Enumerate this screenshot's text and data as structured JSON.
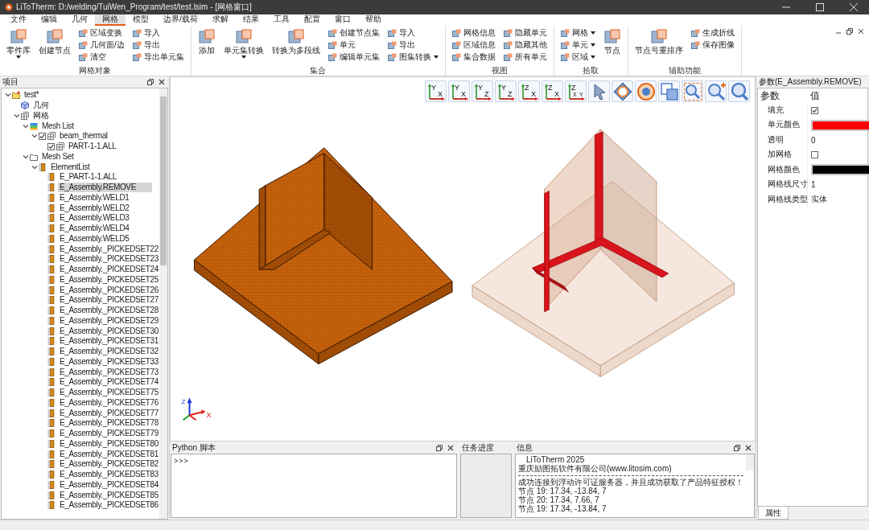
{
  "window": {
    "title": "LiToTherm: D:/welding/TuiWen_Program/test/test.lsim - [网格窗口]"
  },
  "menu": [
    {
      "label": "文件",
      "selected": false
    },
    {
      "label": "编辑",
      "selected": false
    },
    {
      "label": "几何",
      "selected": false
    },
    {
      "label": "网格",
      "selected": true
    },
    {
      "label": "模型",
      "selected": false
    },
    {
      "label": "边界/载荷",
      "selected": false
    },
    {
      "label": "求解",
      "selected": false
    },
    {
      "label": "结果",
      "selected": false
    },
    {
      "label": "工具",
      "selected": false
    },
    {
      "label": "配置",
      "selected": false
    },
    {
      "label": "窗口",
      "selected": false
    },
    {
      "label": "帮助",
      "selected": false
    }
  ],
  "ribbon": {
    "groups": [
      {
        "label": "网格对象",
        "items": [
          {
            "kind": "large",
            "label": "零件库",
            "dropdown": true
          },
          {
            "kind": "large",
            "label": "创建节点",
            "dropdown": false
          },
          {
            "kind": "column",
            "buttons": [
              {
                "label": "区域变换",
                "dropdown": false
              },
              {
                "label": "几何面/边",
                "dropdown": false
              },
              {
                "label": "清空",
                "dropdown": false
              }
            ]
          },
          {
            "kind": "column",
            "buttons": [
              {
                "label": "导入",
                "dropdown": false
              },
              {
                "label": "导出",
                "dropdown": false
              },
              {
                "label": "导出单元集",
                "dropdown": false
              }
            ]
          }
        ]
      },
      {
        "label": "集合",
        "items": [
          {
            "kind": "large",
            "label": "添加",
            "dropdown": false
          },
          {
            "kind": "large",
            "label": "单元集转换",
            "dropdown": true
          },
          {
            "kind": "large",
            "label": "转换为多段线",
            "dropdown": false
          },
          {
            "kind": "column",
            "buttons": [
              {
                "label": "创建节点集",
                "dropdown": false
              },
              {
                "label": "单元",
                "dropdown": false
              },
              {
                "label": "编辑单元集",
                "dropdown": false
              }
            ]
          },
          {
            "kind": "column",
            "buttons": [
              {
                "label": "导入",
                "dropdown": false
              },
              {
                "label": "导出",
                "dropdown": false
              },
              {
                "label": "图集转换",
                "dropdown": true
              }
            ]
          }
        ]
      },
      {
        "label": "视图",
        "items": [
          {
            "kind": "column",
            "buttons": [
              {
                "label": "网格信息",
                "dropdown": false
              },
              {
                "label": "区域信息",
                "dropdown": false
              },
              {
                "label": "集合数据",
                "dropdown": false
              }
            ]
          },
          {
            "kind": "column",
            "buttons": [
              {
                "label": "隐藏单元",
                "dropdown": false
              },
              {
                "label": "隐藏其他",
                "dropdown": false
              },
              {
                "label": "所有单元",
                "dropdown": false
              }
            ]
          }
        ]
      },
      {
        "label": "拾取",
        "items": [
          {
            "kind": "column",
            "buttons": [
              {
                "label": "网格",
                "dropdown": true
              },
              {
                "label": "单元",
                "dropdown": true
              },
              {
                "label": "区域",
                "dropdown": true
              }
            ]
          },
          {
            "kind": "large",
            "label": "节点",
            "dropdown": false
          }
        ]
      },
      {
        "label": "辅助功能",
        "items": [
          {
            "kind": "large",
            "label": "节点号重排序",
            "dropdown": false
          },
          {
            "kind": "column",
            "buttons": [
              {
                "label": "生成折线",
                "dropdown": false
              },
              {
                "label": "保存图像",
                "dropdown": false
              }
            ]
          }
        ]
      }
    ]
  },
  "tree": {
    "title": "项目",
    "items": [
      {
        "label": "test*",
        "kind": "project",
        "expanded": true,
        "selected": false,
        "children": [
          {
            "label": "几何",
            "kind": "geometry",
            "selected": false
          },
          {
            "label": "网格",
            "kind": "mesh",
            "expanded": true,
            "selected": false,
            "children": [
              {
                "label": "Mesh List",
                "kind": "meshlist",
                "expanded": true,
                "selected": false,
                "children": [
                  {
                    "label": "beam_thermal",
                    "kind": "mesh",
                    "checked": true,
                    "expanded": true,
                    "selected": false,
                    "children": [
                      {
                        "label": "PART-1-1.ALL",
                        "kind": "mesh",
                        "checked": true,
                        "selected": false
                      }
                    ]
                  }
                ]
              },
              {
                "label": "Mesh Set",
                "kind": "folder",
                "expanded": true,
                "selected": false,
                "children": [
                  {
                    "label": "ElementList",
                    "kind": "element",
                    "expanded": true,
                    "selected": false,
                    "children": [
                      {
                        "label": "E_PART-1-1.ALL",
                        "kind": "element",
                        "selected": false
                      },
                      {
                        "label": "E_Assembly.REMOVE",
                        "kind": "element",
                        "selected": true
                      },
                      {
                        "label": "E_Assembly.WELD1",
                        "kind": "element",
                        "selected": false
                      },
                      {
                        "label": "E_Assembly.WELD2",
                        "kind": "element",
                        "selected": false
                      },
                      {
                        "label": "E_Assembly.WELD3",
                        "kind": "element",
                        "selected": false
                      },
                      {
                        "label": "E_Assembly.WELD4",
                        "kind": "element",
                        "selected": false
                      },
                      {
                        "label": "E_Assembly.WELD5",
                        "kind": "element",
                        "selected": false
                      },
                      {
                        "label": "E_Assembly._PICKEDSET22",
                        "kind": "element",
                        "selected": false
                      },
                      {
                        "label": "E_Assembly._PICKEDSET23",
                        "kind": "element",
                        "selected": false
                      },
                      {
                        "label": "E_Assembly._PICKEDSET24",
                        "kind": "element",
                        "selected": false
                      },
                      {
                        "label": "E_Assembly._PICKEDSET25",
                        "kind": "element",
                        "selected": false
                      },
                      {
                        "label": "E_Assembly._PICKEDSET26",
                        "kind": "element",
                        "selected": false
                      },
                      {
                        "label": "E_Assembly._PICKEDSET27",
                        "kind": "element",
                        "selected": false
                      },
                      {
                        "label": "E_Assembly._PICKEDSET28",
                        "kind": "element",
                        "selected": false
                      },
                      {
                        "label": "E_Assembly._PICKEDSET29",
                        "kind": "element",
                        "selected": false
                      },
                      {
                        "label": "E_Assembly._PICKEDSET30",
                        "kind": "element",
                        "selected": false
                      },
                      {
                        "label": "E_Assembly._PICKEDSET31",
                        "kind": "element",
                        "selected": false
                      },
                      {
                        "label": "E_Assembly._PICKEDSET32",
                        "kind": "element",
                        "selected": false
                      },
                      {
                        "label": "E_Assembly._PICKEDSET33",
                        "kind": "element",
                        "selected": false
                      },
                      {
                        "label": "E_Assembly._PICKEDSET73",
                        "kind": "element",
                        "selected": false
                      },
                      {
                        "label": "E_Assembly._PICKEDSET74",
                        "kind": "element",
                        "selected": false
                      },
                      {
                        "label": "E_Assembly._PICKEDSET75",
                        "kind": "element",
                        "selected": false
                      },
                      {
                        "label": "E_Assembly._PICKEDSET76",
                        "kind": "element",
                        "selected": false
                      },
                      {
                        "label": "E_Assembly._PICKEDSET77",
                        "kind": "element",
                        "selected": false
                      },
                      {
                        "label": "E_Assembly._PICKEDSET78",
                        "kind": "element",
                        "selected": false
                      },
                      {
                        "label": "E_Assembly._PICKEDSET79",
                        "kind": "element",
                        "selected": false
                      },
                      {
                        "label": "E_Assembly._PICKEDSET80",
                        "kind": "element",
                        "selected": false
                      },
                      {
                        "label": "E_Assembly._PICKEDSET81",
                        "kind": "element",
                        "selected": false
                      },
                      {
                        "label": "E_Assembly._PICKEDSET82",
                        "kind": "element",
                        "selected": false
                      },
                      {
                        "label": "E_Assembly._PICKEDSET83",
                        "kind": "element",
                        "selected": false
                      },
                      {
                        "label": "E_Assembly._PICKEDSET84",
                        "kind": "element",
                        "selected": false
                      },
                      {
                        "label": "E_Assembly._PICKEDSET85",
                        "kind": "element",
                        "selected": false
                      },
                      {
                        "label": "E_Assembly._PICKEDSET86",
                        "kind": "element",
                        "selected": false
                      }
                    ]
                  }
                ]
              }
            ]
          }
        ]
      }
    ]
  },
  "view_toolbar": [
    {
      "kind": "axes",
      "labels": [
        "Y",
        "X"
      ]
    },
    {
      "kind": "axes",
      "labels": [
        "Y",
        "X"
      ]
    },
    {
      "kind": "axes",
      "labels": [
        "Y",
        "Z"
      ]
    },
    {
      "kind": "axes",
      "labels": [
        "Y",
        "Z"
      ]
    },
    {
      "kind": "axes",
      "labels": [
        "Z",
        "X"
      ]
    },
    {
      "kind": "axes",
      "labels": [
        "Z",
        "X"
      ]
    },
    {
      "kind": "axes",
      "labels": [
        "Z",
        "X",
        "Y"
      ]
    },
    {
      "kind": "pointer"
    },
    {
      "kind": "rotate"
    },
    {
      "kind": "circle"
    },
    {
      "kind": "box"
    },
    {
      "kind": "zoom-window"
    },
    {
      "kind": "zoom-in"
    },
    {
      "kind": "zoom-fit"
    }
  ],
  "triad": {
    "labels": [
      "Z",
      "X"
    ]
  },
  "properties": {
    "title": "参数(E_Assembly.REMOVE)",
    "columns": [
      "参数",
      "值"
    ],
    "rows": [
      {
        "name": "填充",
        "kind": "checkbox",
        "checked": true
      },
      {
        "name": "单元颜色",
        "kind": "color",
        "color": "#ff0000"
      },
      {
        "name": "透明",
        "kind": "text",
        "value": "0"
      },
      {
        "name": "加网格",
        "kind": "checkbox",
        "checked": false
      },
      {
        "name": "网格颜色",
        "kind": "color",
        "color": "#000000"
      },
      {
        "name": "网格线尺寸",
        "kind": "text",
        "value": "1"
      },
      {
        "name": "网格线类型",
        "kind": "text",
        "value": "实体"
      }
    ],
    "tab": "属性"
  },
  "python": {
    "title": "Python 脚本",
    "prompt": ">>>"
  },
  "tasks": {
    "title": "任务进度"
  },
  "info": {
    "title": "信息",
    "lines": [
      {
        "kind": "title",
        "text": "LiToTherm 2025"
      },
      {
        "kind": "text",
        "text": "重庆励图拓软件有限公司(www.litosim.com)"
      },
      {
        "kind": "rule"
      },
      {
        "kind": "text",
        "text": "成功连接到浮动许可证服务器，并且成功获取了产品特征授权！"
      },
      {
        "kind": "text",
        "text": "节点 19: 17.34, -13.84, 7"
      },
      {
        "kind": "text",
        "text": "节点 20: 17.34, 7.66, 7"
      },
      {
        "kind": "text",
        "text": "节点 19: 17.34, -13.84, 7"
      }
    ]
  }
}
